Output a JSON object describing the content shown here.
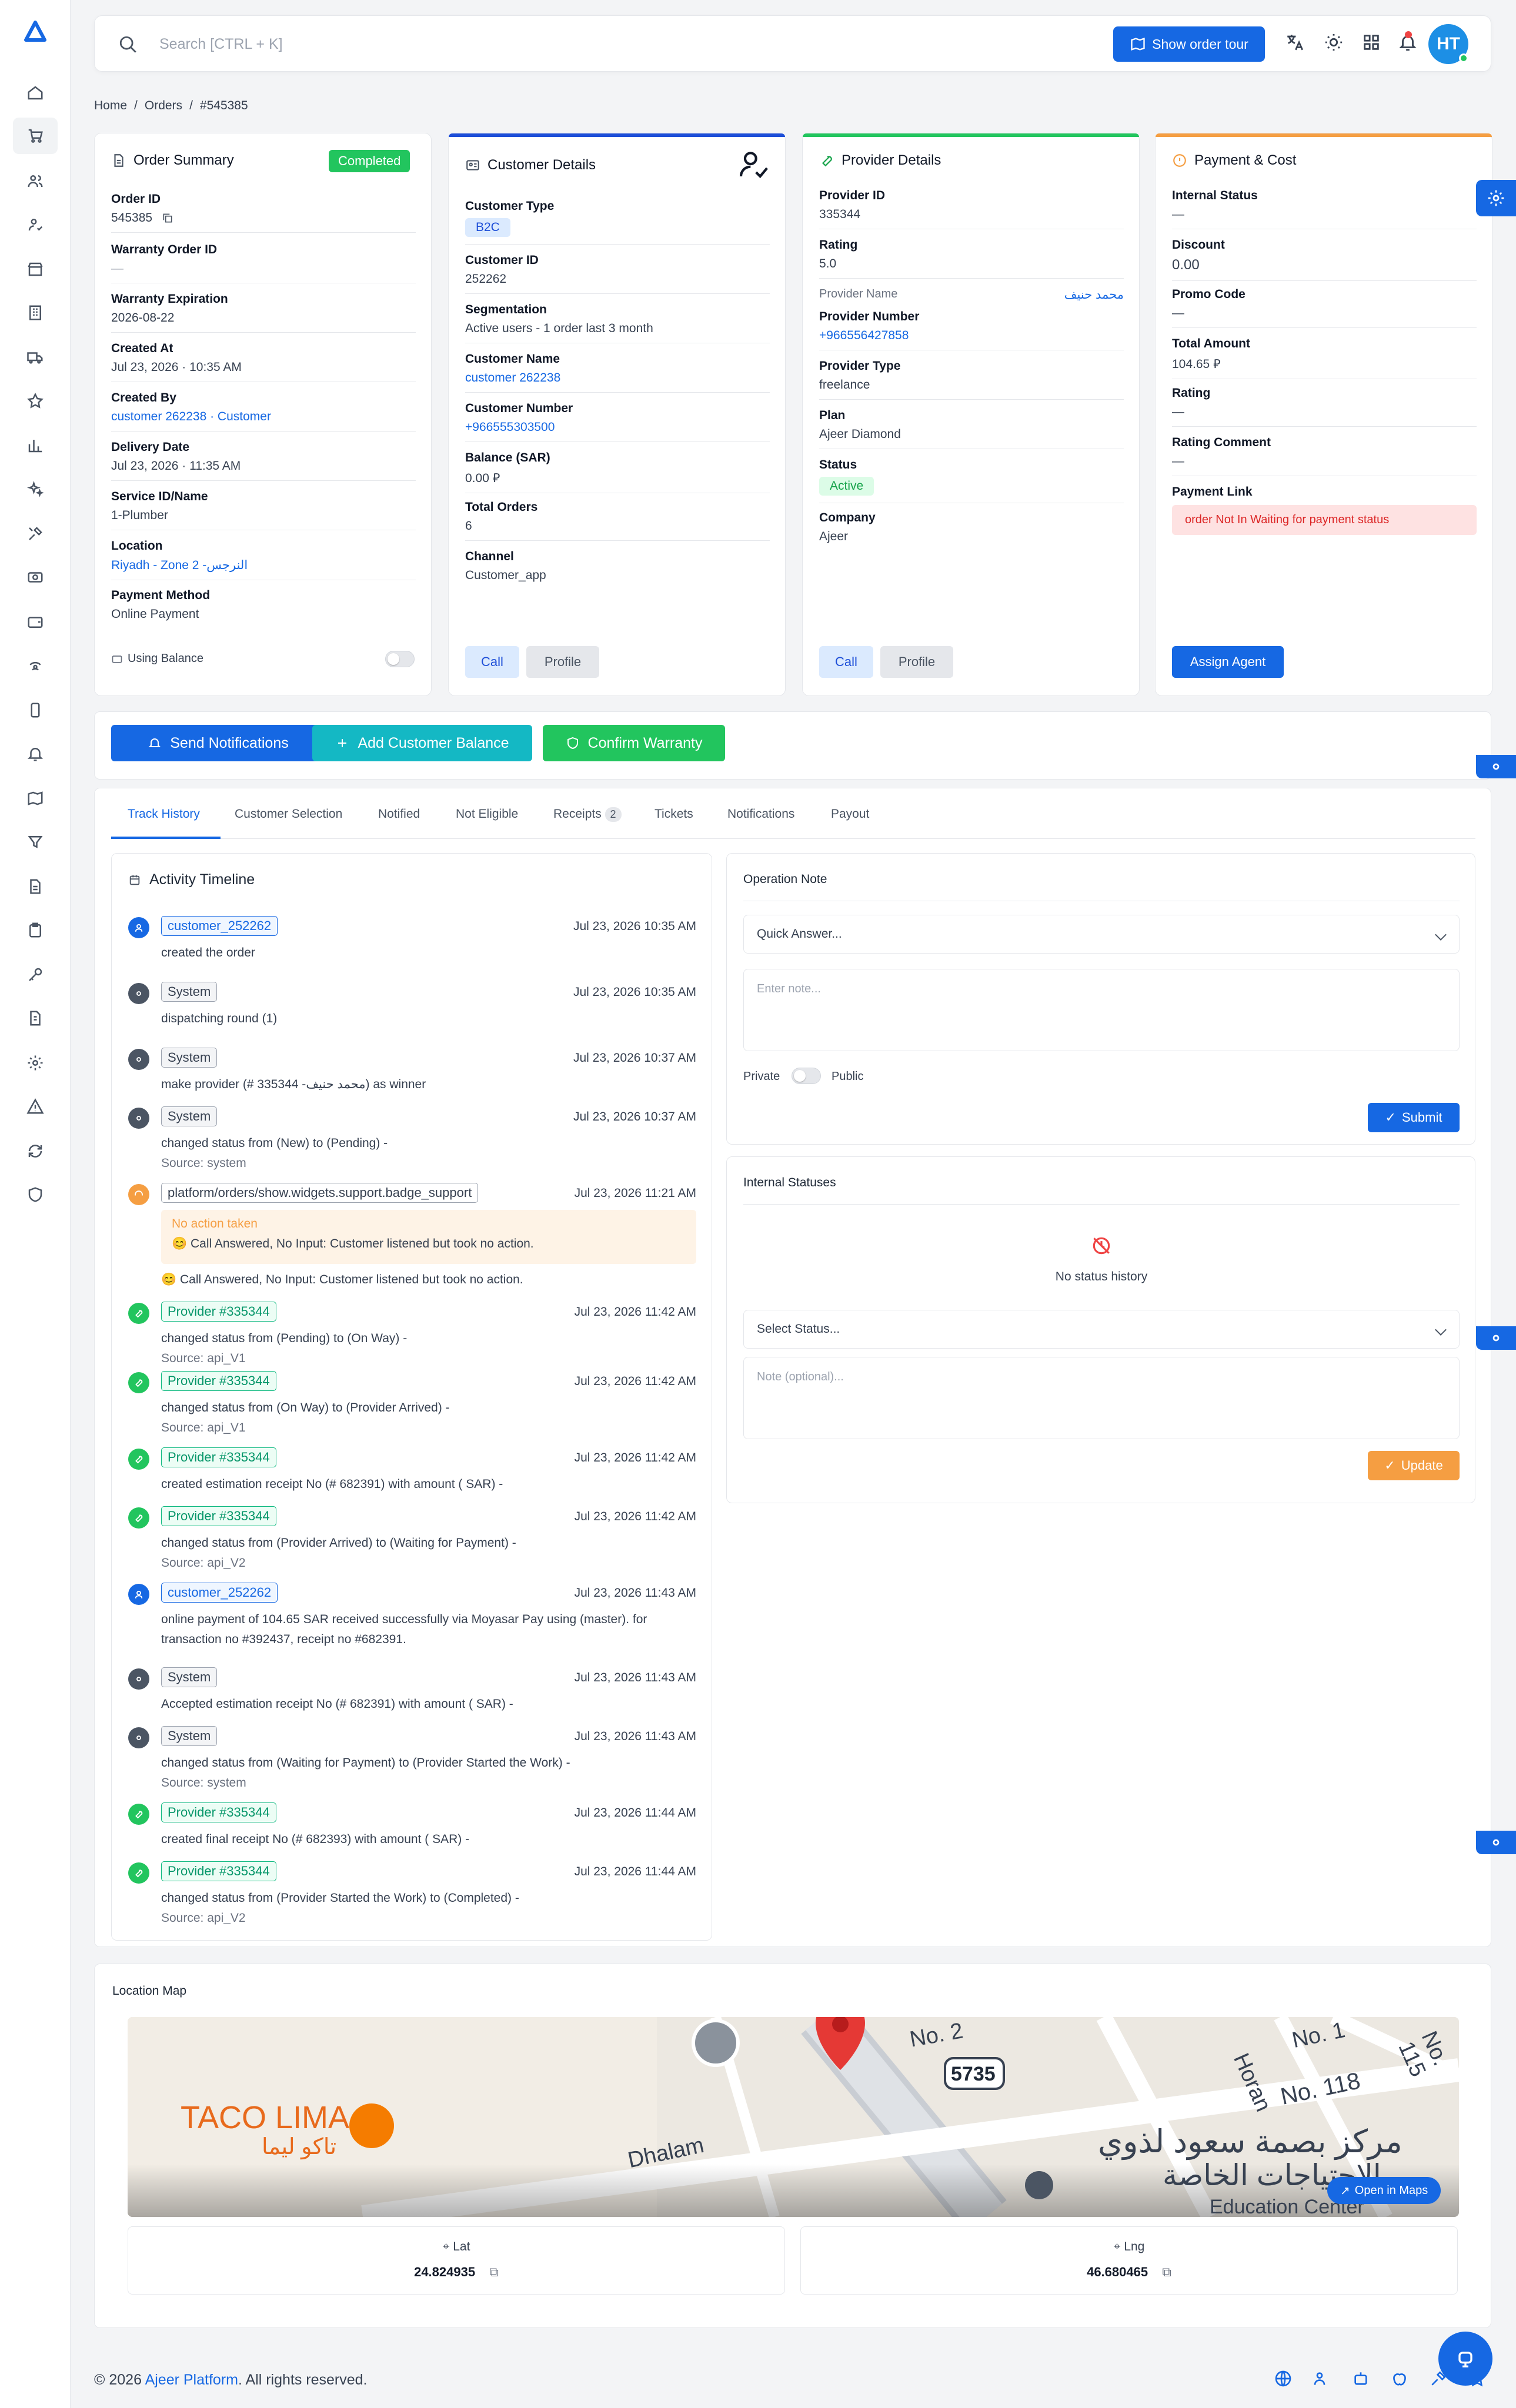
{
  "search": {
    "placeholder": "Search [CTRL + K]"
  },
  "topbar": {
    "tour_label": "Show order tour",
    "avatar_initials": "HT"
  },
  "breadcrumb": [
    "Home",
    "/",
    "Orders",
    "/",
    "#545385"
  ],
  "order_summary": {
    "title": "Order Summary",
    "status": "Completed",
    "fields": [
      {
        "label": "Order ID",
        "value": "545385"
      },
      {
        "label": "Warranty Order ID",
        "value": "—"
      },
      {
        "label": "Warranty Expiration",
        "value": "2026-08-22"
      },
      {
        "label": "Created At",
        "value": "Jul 23, 2026 · 10:35 AM"
      },
      {
        "label": "Created By",
        "value": "customer 262238 · Customer"
      },
      {
        "label": "Delivery Date",
        "value": "Jul 23, 2026 · 11:35 AM"
      },
      {
        "label": "Service ID/Name",
        "value": "1-Plumber"
      },
      {
        "label": "Location",
        "value": "Riyadh - Zone 2 -النرجس"
      },
      {
        "label": "Payment Method",
        "value": "Online Payment"
      }
    ],
    "using_balance": "Using Balance"
  },
  "customer": {
    "title": "Customer Details",
    "fields": [
      {
        "label": "Customer Type",
        "value": "B2C"
      },
      {
        "label": "Customer ID",
        "value": "252262"
      },
      {
        "label": "Segmentation",
        "value": "Active users - 1 order last 3 month"
      },
      {
        "label": "Customer Name",
        "value": "customer 262238"
      },
      {
        "label": "Customer Number",
        "value": "+966555303500"
      },
      {
        "label": "Balance (SAR)",
        "value": "0.00 ⃁"
      },
      {
        "label": "Total Orders",
        "value": "6"
      },
      {
        "label": "Channel",
        "value": "Customer_app"
      }
    ],
    "call": "Call",
    "profile": "Profile"
  },
  "provider": {
    "title": "Provider Details",
    "fields": [
      {
        "label": "Provider ID",
        "value": "335344"
      },
      {
        "label": "Rating",
        "value": "5.0"
      },
      {
        "label": "Provider Name",
        "value": "محمد حنيف"
      },
      {
        "label": "Provider Number",
        "value": "+966556427858"
      },
      {
        "label": "Provider Type",
        "value": "freelance"
      },
      {
        "label": "Plan",
        "value": "Ajeer Diamond"
      },
      {
        "label": "Status",
        "value": "Active"
      },
      {
        "label": "Company",
        "value": "Ajeer"
      }
    ],
    "call": "Call",
    "profile": "Profile"
  },
  "payment": {
    "title": "Payment & Cost",
    "fields": [
      {
        "label": "Internal Status",
        "value": "—"
      },
      {
        "label": "Discount",
        "value": "0.00"
      },
      {
        "label": "Promo Code",
        "value": "—"
      },
      {
        "label": "Total Amount",
        "value": "104.65 ⃁"
      },
      {
        "label": "Rating",
        "value": "—"
      },
      {
        "label": "Rating Comment",
        "value": "—"
      },
      {
        "label": "Payment Link",
        "value": "order Not In Waiting for payment status"
      }
    ],
    "assign": "Assign Agent"
  },
  "actions": {
    "send": "Send Notifications",
    "add_balance": "Add Customer Balance",
    "confirm": "Confirm Warranty"
  },
  "tabs": [
    "Track History",
    "Customer Selection",
    "Notified",
    "Not Eligible",
    "Receipts",
    "Tickets",
    "Notifications",
    "Payout"
  ],
  "receipts_count": "2",
  "timeline": {
    "title": "Activity Timeline",
    "events": [
      {
        "actor": "customer_252262",
        "time": "Jul 23, 2026 10:35 AM",
        "text": "created the order",
        "source": ""
      },
      {
        "actor": "System",
        "time": "Jul 23, 2026 10:35 AM",
        "text": "dispatching round (1)",
        "source": ""
      },
      {
        "actor": "System",
        "time": "Jul 23, 2026 10:37 AM",
        "text": "make provider (# 335344 -محمد حنيف) as winner",
        "source": ""
      },
      {
        "actor": "System",
        "time": "Jul 23, 2026 10:37 AM",
        "text": "changed status from (New) to (Pending) -",
        "source": "Source: system"
      },
      {
        "actor": "platform/orders/show.widgets.support.badge_support",
        "time": "Jul 23, 2026 11:21 AM",
        "text": "😊 Call Answered, No Input: Customer listened but took no action.",
        "source": ""
      },
      {
        "actor": "Provider #335344",
        "time": "Jul 23, 2026 11:42 AM",
        "text": "changed status from (Pending) to (On Way) -",
        "source": "Source: api_V1"
      },
      {
        "actor": "Provider #335344",
        "time": "Jul 23, 2026 11:42 AM",
        "text": "changed status from (On Way) to (Provider Arrived) -",
        "source": "Source: api_V1"
      },
      {
        "actor": "Provider #335344",
        "time": "Jul 23, 2026 11:42 AM",
        "text": "created estimation receipt No (# 682391) with amount ( SAR) -",
        "source": ""
      },
      {
        "actor": "Provider #335344",
        "time": "Jul 23, 2026 11:42 AM",
        "text": "changed status from (Provider Arrived) to (Waiting for Payment) -",
        "source": "Source: api_V2"
      },
      {
        "actor": "customer_252262",
        "time": "Jul 23, 2026 11:43 AM",
        "text": "online payment of 104.65 SAR received successfully via Moyasar Pay using (master). for transaction no #392437, receipt no #682391.",
        "source": ""
      },
      {
        "actor": "System",
        "time": "Jul 23, 2026 11:43 AM",
        "text": "Accepted estimation receipt No (# 682391) with amount ( SAR) -",
        "source": ""
      },
      {
        "actor": "System",
        "time": "Jul 23, 2026 11:43 AM",
        "text": "changed status from (Waiting for Payment) to (Provider Started the Work) -",
        "source": "Source: system"
      },
      {
        "actor": "Provider #335344",
        "time": "Jul 23, 2026 11:44 AM",
        "text": "created final receipt No (# 682393) with amount ( SAR) -",
        "source": ""
      },
      {
        "actor": "Provider #335344",
        "time": "Jul 23, 2026 11:44 AM",
        "text": "changed status from (Provider Started the Work) to (Completed) -",
        "source": "Source: api_V2"
      }
    ],
    "support_box_title": "No action taken",
    "support_box_text": "😊 Call Answered, No Input: Customer listened but took no action."
  },
  "operation_note": {
    "title": "Operation Note",
    "quick": "Quick Answer...",
    "placeholder": "Enter note...",
    "private": "Private",
    "public": "Public",
    "submit": "Submit"
  },
  "internal_statuses": {
    "title": "Internal Statuses",
    "empty": "No status history",
    "select": "Select Status...",
    "placeholder": "Note (optional)...",
    "update": "Update"
  },
  "map": {
    "title": "Location Map",
    "open": "Open in Maps",
    "lat_label": "Lat",
    "lat": "24.824935",
    "lng_label": "Lng",
    "lng": "46.680465",
    "labels": {
      "taco": "TACO LIMA",
      "taco_ar": "تاكو ليما",
      "dhalam": "Dhalam",
      "road": "5735",
      "no118": "No. 118",
      "horan": "Horan",
      "center_ar": "مركز بصمة سعود لذوي",
      "center_ar2": "الاحتياجات الخاصة",
      "edu": "Education Center",
      "no1": "No. 1",
      "no115": "No. 115",
      "no2": "No. 2"
    }
  },
  "footer": {
    "prefix": "© 2026 ",
    "brand": "Ajeer Platform",
    "suffix": ". All rights reserved."
  },
  "colors": {
    "primary": "#1668e3",
    "success": "#22c55e",
    "teal": "#14b8c4",
    "danger": "#ef4444",
    "orange": "#f59e42"
  }
}
